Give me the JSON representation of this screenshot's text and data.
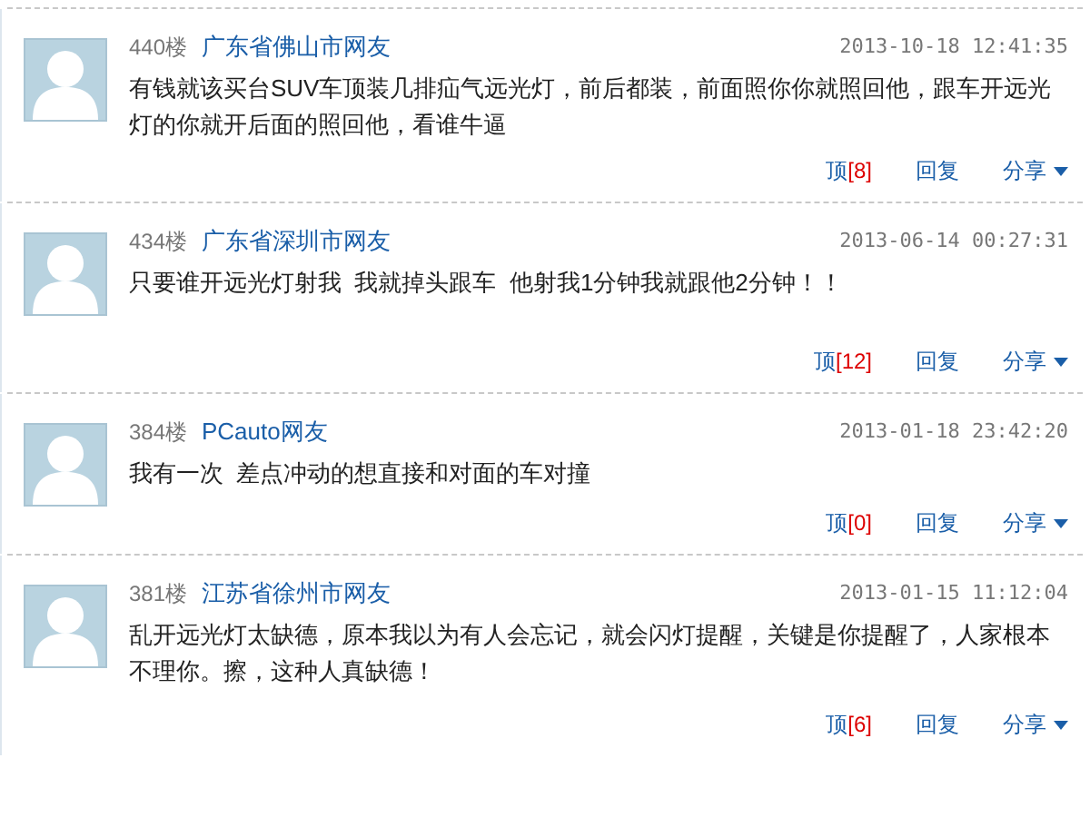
{
  "comments": [
    {
      "floor": "440楼",
      "user": "广东省佛山市网友",
      "time": "2013-10-18 12:41:35",
      "text": "有钱就该买台SUV车顶装几排疝气远光灯，前后都装，前面照你你就照回他，跟车开远光灯的你就开后面的照回他，看谁牛逼",
      "vote_label": "顶",
      "vote_count": "[8]",
      "reply": "回复",
      "share": "分享"
    },
    {
      "floor": "434楼",
      "user": "广东省深圳市网友",
      "time": "2013-06-14 00:27:31",
      "text": "只要谁开远光灯射我  我就掉头跟车  他射我1分钟我就跟他2分钟！！",
      "vote_label": "顶",
      "vote_count": "[12]",
      "reply": "回复",
      "share": "分享"
    },
    {
      "floor": "384楼",
      "user": "PCauto网友",
      "time": "2013-01-18 23:42:20",
      "text": "我有一次  差点冲动的想直接和对面的车对撞",
      "vote_label": "顶",
      "vote_count": "[0]",
      "reply": "回复",
      "share": "分享"
    },
    {
      "floor": "381楼",
      "user": "江苏省徐州市网友",
      "time": "2013-01-15 11:12:04",
      "text": "乱开远光灯太缺德，原本我以为有人会忘记，就会闪灯提醒，关键是你提醒了，人家根本不理你。擦，这种人真缺德！",
      "vote_label": "顶",
      "vote_count": "[6]",
      "reply": "回复",
      "share": "分享"
    }
  ]
}
